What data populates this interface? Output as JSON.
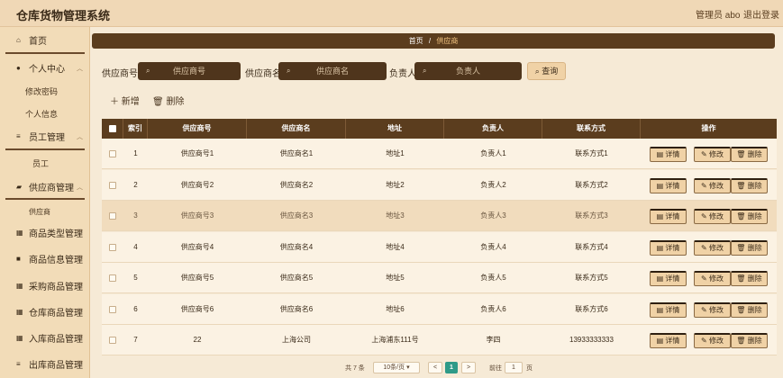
{
  "header": {
    "title": "仓库货物管理系统",
    "user": "管理员 abo",
    "logout": "退出登录"
  },
  "sidebar": {
    "items": [
      {
        "label": "首页",
        "icon": "home-icon"
      },
      {
        "label": "个人中心",
        "icon": "user-icon"
      },
      {
        "label": "员工管理",
        "icon": "list-icon"
      },
      {
        "label": "供应商管理",
        "icon": "truck-icon"
      },
      {
        "label": "商品类型管理",
        "icon": "grid-icon"
      },
      {
        "label": "商品信息管理",
        "icon": "box-icon"
      },
      {
        "label": "采购商品管理",
        "icon": "grid-icon"
      },
      {
        "label": "仓库商品管理",
        "icon": "grid-icon"
      },
      {
        "label": "入库商品管理",
        "icon": "grid-icon"
      },
      {
        "label": "出库商品管理",
        "icon": "list-icon"
      }
    ],
    "subitems": {
      "personal": [
        "修改密码",
        "个人信息"
      ],
      "staff": [
        "员工"
      ],
      "supplier": [
        "供应商"
      ]
    }
  },
  "breadcrumb": {
    "home": "首页",
    "sep": "/",
    "current": "供应商"
  },
  "filters": {
    "code_label": "供应商号",
    "code_placeholder": "供应商号",
    "name_label": "供应商名",
    "name_placeholder": "供应商名",
    "owner_label": "负责人",
    "owner_placeholder": "负责人",
    "search": "查询"
  },
  "toolbar": {
    "add": "新增",
    "delete": "删除"
  },
  "table": {
    "headers": [
      "索引",
      "供应商号",
      "供应商名",
      "地址",
      "负责人",
      "联系方式",
      "操作"
    ],
    "rows": [
      [
        "1",
        "供应商号1",
        "供应商名1",
        "地址1",
        "负责人1",
        "联系方式1"
      ],
      [
        "2",
        "供应商号2",
        "供应商名2",
        "地址2",
        "负责人2",
        "联系方式2"
      ],
      [
        "3",
        "供应商号3",
        "供应商名3",
        "地址3",
        "负责人3",
        "联系方式3"
      ],
      [
        "4",
        "供应商号4",
        "供应商名4",
        "地址4",
        "负责人4",
        "联系方式4"
      ],
      [
        "5",
        "供应商号5",
        "供应商名5",
        "地址5",
        "负责人5",
        "联系方式5"
      ],
      [
        "6",
        "供应商号6",
        "供应商名6",
        "地址6",
        "负责人6",
        "联系方式6"
      ],
      [
        "7",
        "22",
        "上海公司",
        "上海浦东111号",
        "李四",
        "13933333333"
      ]
    ],
    "row_actions": {
      "detail": "详情",
      "edit": "修改",
      "delete": "删除"
    }
  },
  "pager": {
    "total": "共 7 条",
    "page_size": "10条/页",
    "prev": "<",
    "current": "1",
    "next": ">",
    "goto": "前往",
    "goto_value": "1",
    "page_unit": "页"
  },
  "colors": {
    "accent": "#5b3d1e",
    "highlight": "#f1dcbd",
    "button": "#f0d2a6",
    "pager_active": "#2e9a88"
  }
}
